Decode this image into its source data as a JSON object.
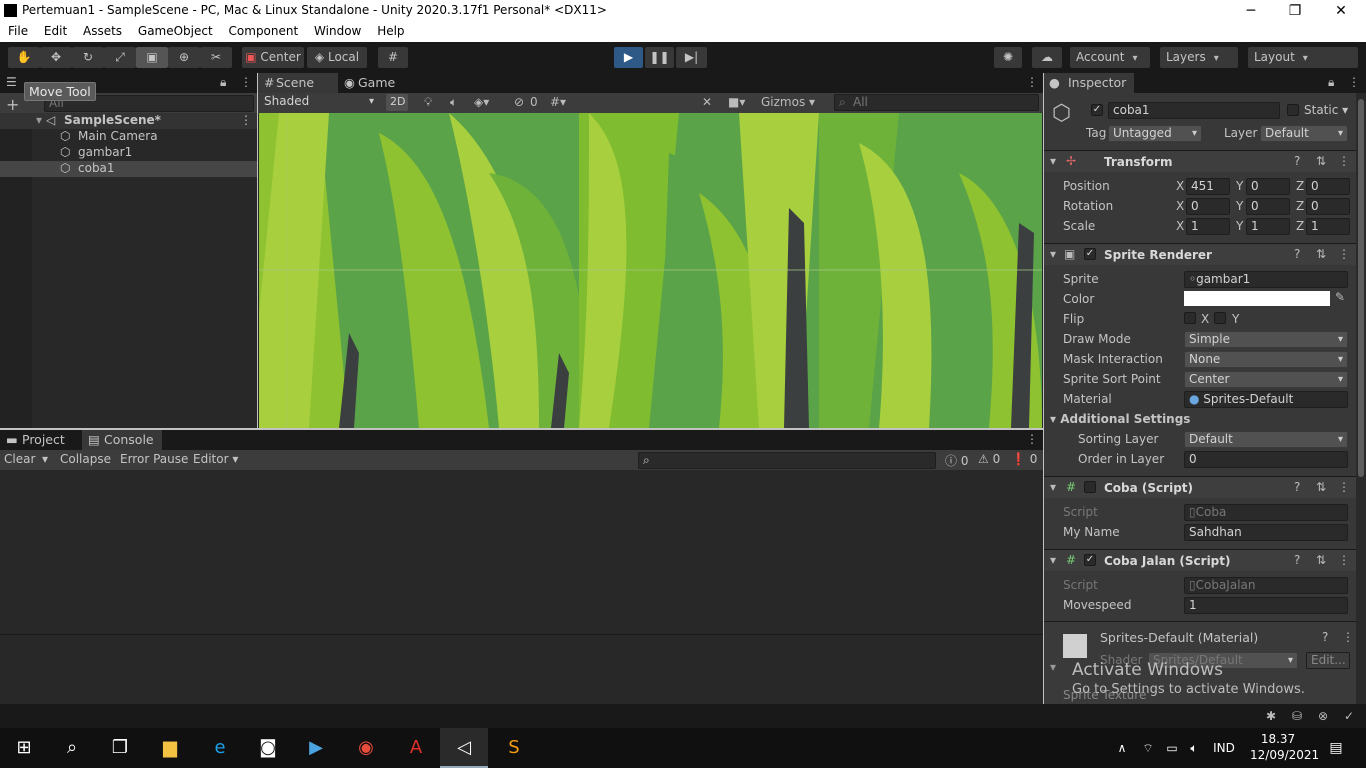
{
  "window": {
    "title": "Pertemuan1 - SampleScene - PC, Mac & Linux Standalone - Unity 2020.3.17f1 Personal* <DX11>"
  },
  "menu": [
    "File",
    "Edit",
    "Assets",
    "GameObject",
    "Component",
    "Window",
    "Help"
  ],
  "toolbar": {
    "pivot": "Center",
    "space": "Local",
    "account": "Account",
    "layers": "Layers",
    "layout": "Layout"
  },
  "hierarchy": {
    "tooltip": "Move Tool",
    "search_placeholder": "All",
    "scene": "SampleScene*",
    "items": [
      "Main Camera",
      "gambar1",
      "coba1"
    ]
  },
  "scene_view": {
    "tabs": [
      "Scene",
      "Game"
    ],
    "shading": "Shaded",
    "mode_2d": "2D",
    "hidden_count": "0",
    "gizmos": "Gizmos",
    "search_placeholder": "All"
  },
  "console": {
    "tabs": [
      "Project",
      "Console"
    ],
    "clear": "Clear",
    "collapse": "Collapse",
    "error_pause": "Error Pause",
    "editor": "Editor",
    "log_count": "0",
    "warn_count": "0",
    "error_count": "0"
  },
  "inspector": {
    "tab": "Inspector",
    "object_name": "coba1",
    "static": "Static",
    "tag_label": "Tag",
    "tag": "Untagged",
    "layer_label": "Layer",
    "layer": "Default",
    "transform": {
      "title": "Transform",
      "position_label": "Position",
      "rotation_label": "Rotation",
      "scale_label": "Scale",
      "position": [
        "451",
        "0",
        "0"
      ],
      "rotation": [
        "0",
        "0",
        "0"
      ],
      "scale": [
        "1",
        "1",
        "1"
      ]
    },
    "sprite_renderer": {
      "title": "Sprite Renderer",
      "sprite_label": "Sprite",
      "sprite": "gambar1",
      "color_label": "Color",
      "flip_label": "Flip",
      "flip_x": "X",
      "flip_y": "Y",
      "draw_mode_label": "Draw Mode",
      "draw_mode": "Simple",
      "mask_label": "Mask Interaction",
      "mask": "None",
      "sort_point_label": "Sprite Sort Point",
      "sort_point": "Center",
      "material_label": "Material",
      "material": "Sprites-Default",
      "additional": "Additional Settings",
      "sorting_layer_label": "Sorting Layer",
      "sorting_layer": "Default",
      "order_label": "Order in Layer",
      "order": "0"
    },
    "coba_script": {
      "title": "Coba (Script)",
      "script_label": "Script",
      "script": "Coba",
      "myname_label": "My Name",
      "myname": "Sahdhan"
    },
    "coba_jalan_script": {
      "title": "Coba Jalan (Script)",
      "script_label": "Script",
      "script": "CobaJalan",
      "movespeed_label": "Movespeed",
      "movespeed": "1"
    },
    "material": {
      "title": "Sprites-Default (Material)",
      "shader_label": "Shader",
      "shader": "Sprites/Default",
      "edit": "Edit...",
      "texture_label": "Sprite Texture"
    },
    "watermark_1": "Activate Windows",
    "watermark_2": "Go to Settings to activate Windows."
  },
  "taskbar": {
    "lang": "IND",
    "time": "18.37",
    "date": "12/09/2021"
  }
}
